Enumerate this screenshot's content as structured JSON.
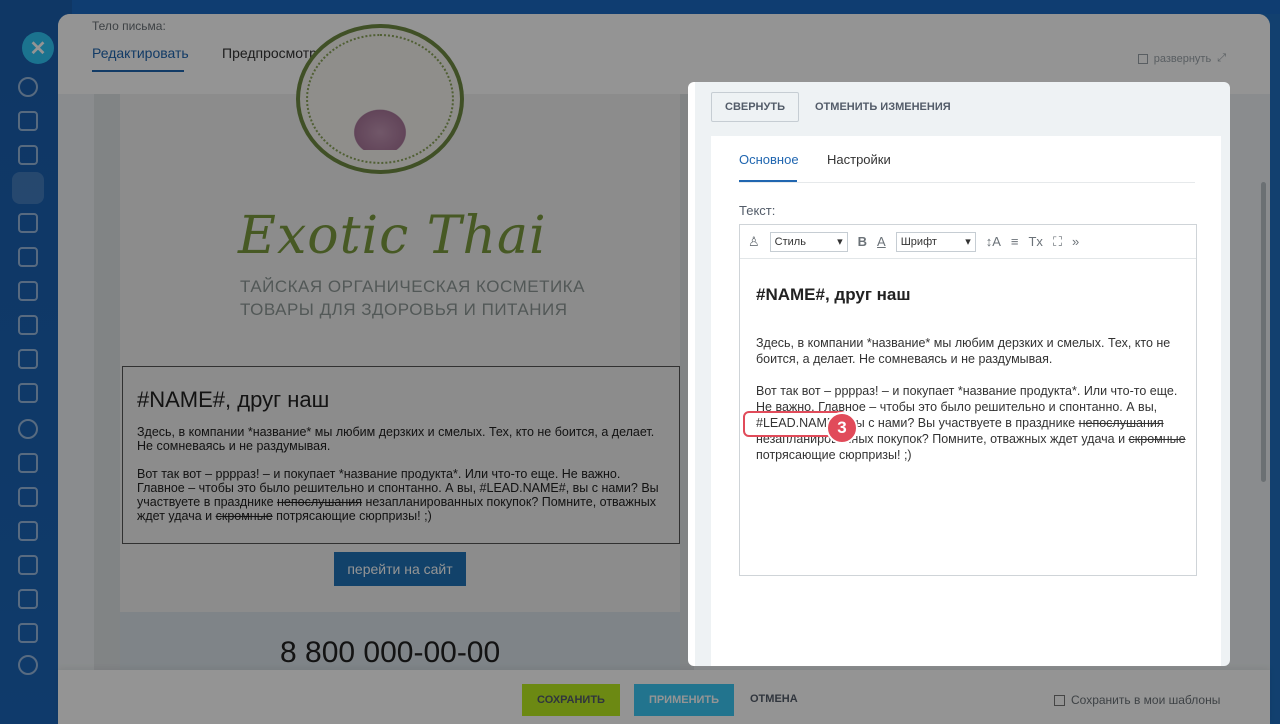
{
  "sidebar": {
    "close_icon": "close-icon",
    "icons": [
      "refresh-icon",
      "chat-icon",
      "doc-icon",
      "edit-icon",
      "calendar-icon",
      "card-icon",
      "file-icon",
      "drive-icon",
      "mail-icon",
      "contacts-icon",
      "target-icon",
      "storage-icon",
      "board-icon",
      "tasks-icon",
      "filter-icon",
      "cart-icon",
      "chart-icon",
      "settings-icon"
    ]
  },
  "header": {
    "body_label": "Тело письма:",
    "tab_edit": "Редактировать",
    "tab_preview": "Предпросмотр",
    "expand_label": "развернуть"
  },
  "email": {
    "logo_title": "Exotic Thai",
    "logo_sub1": "ТАЙСКАЯ ОРГАНИЧЕСКАЯ КОСМЕТИКА",
    "logo_sub2": "ТОВАРЫ ДЛЯ ЗДОРОВЬЯ И ПИТАНИЯ",
    "title": "#NAME#, друг наш",
    "p1": "Здесь, в компании *название* мы любим дерзких и смелых. Тех, кто не боится, а делает. Не сомневаясь и не раздумывая.",
    "p2_a": "Вот так вот – ррррaз! – и покупает *название продукта*. Или что-то еще. Не важно. Главное – чтобы это было решительно и спонтанно. А вы, #LEAD.NAME#, вы с нами? Вы участвуете в празднике ",
    "p2_strike1": "непослушания",
    "p2_b": " незапланированных покупок? Помните, отважных ждет удача и ",
    "p2_strike2": "скромные",
    "p2_c": " потрясающие сюрпризы! ;)",
    "button": "перейти на сайт",
    "phone": "8 800 000-00-00"
  },
  "bottom": {
    "save": "СОХРАНИТЬ",
    "apply": "ПРИМЕНИТЬ",
    "cancel": "ОТМЕНА",
    "save_template": "Сохранить в мои шаблоны"
  },
  "editor": {
    "collapse": "СВЕРНУТЬ",
    "revert": "ОТМЕНИТЬ ИЗМЕНЕНИЯ",
    "tab_main": "Основное",
    "tab_settings": "Настройки",
    "text_label": "Текст:",
    "toolbar": {
      "style": "Стиль",
      "bold": "B",
      "color": "A",
      "font": "Шрифт",
      "size": "↕A",
      "align": "≡",
      "clear": "Tx",
      "fullscreen": "⛶",
      "more": "»"
    },
    "title": "#NAME#, друг наш",
    "p1": "Здесь, в компании *название* мы любим дерзких и смелых. Тех, кто не боится, а делает. Не сомневаясь и не раздумывая.",
    "p2_a": "Вот так вот – ррррaз! – и покупает *название продукта*. Или что-то еще. Не важно. Главное – чтобы это было решительно и спонтанно. А вы, ",
    "p2_lead": "#LEAD.NAME#",
    "p2_b": ", вы с нами? Вы участвуете в празднике ",
    "p2_strike1": "непослушания",
    "p2_c": " незапланированных покупок? Помните, отважных ждет удача и ",
    "p2_strike2": "скромные",
    "p2_d": " потрясающие сюрпризы! ;)"
  },
  "badge": "3",
  "colors": {
    "accent": "#2066b0",
    "save": "#bbed21",
    "apply": "#3bc8f5",
    "highlight": "#e14b5a"
  }
}
